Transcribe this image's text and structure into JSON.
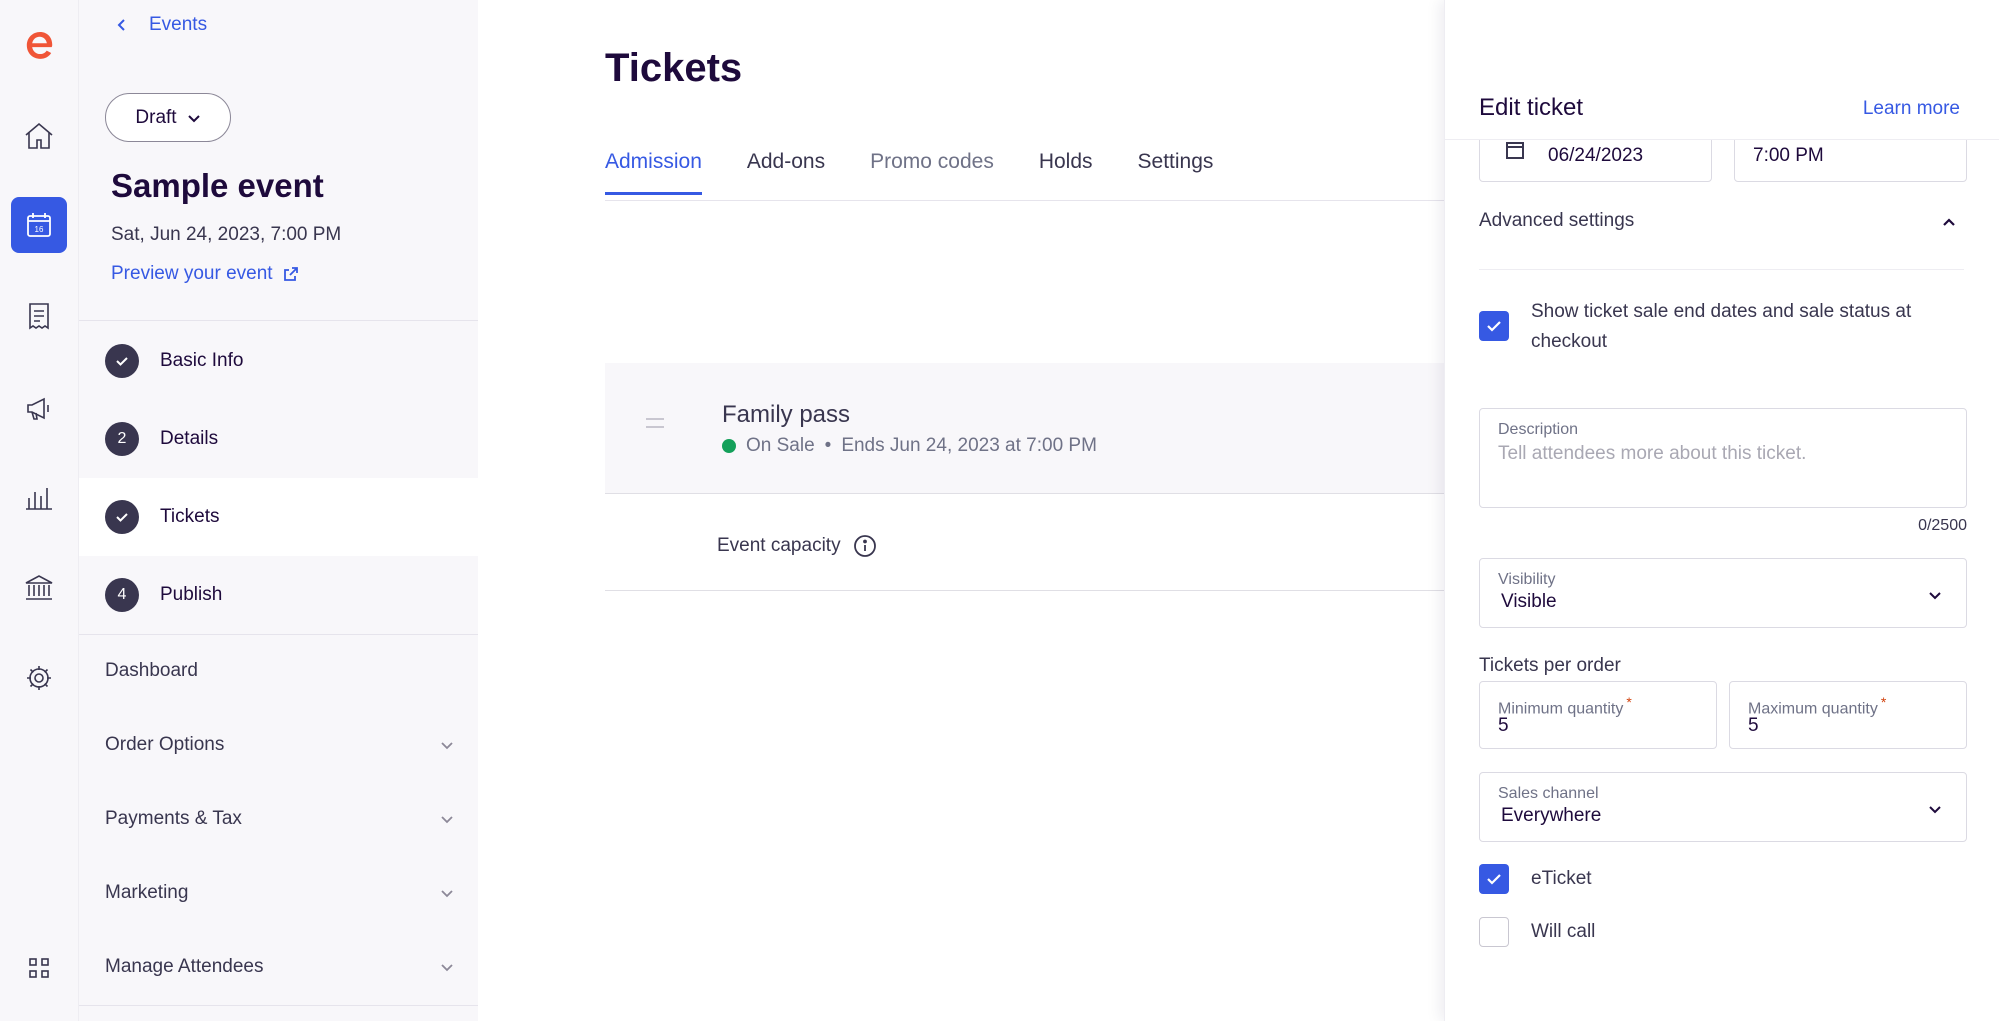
{
  "sidebar": {
    "back_label": "Events",
    "status_button": "Draft",
    "event_title": "Sample event",
    "event_date": "Sat, Jun 24, 2023, 7:00 PM",
    "preview_link": "Preview your event",
    "calendar_day": "16",
    "steps": [
      {
        "label": "Basic Info",
        "marker": "check"
      },
      {
        "label": "Details",
        "marker": "2"
      },
      {
        "label": "Tickets",
        "marker": "check"
      },
      {
        "label": "Publish",
        "marker": "4"
      }
    ],
    "sections": [
      "Dashboard",
      "Order Options",
      "Payments & Tax",
      "Marketing",
      "Manage Attendees"
    ]
  },
  "main": {
    "page_title": "Tickets",
    "tabs": [
      "Admission",
      "Add-ons",
      "Promo codes",
      "Holds",
      "Settings"
    ],
    "active_tab": "Admission",
    "ticket": {
      "name": "Family pass",
      "status": "On Sale",
      "ends": "Ends Jun 24, 2023 at 7:00 PM"
    },
    "capacity_label": "Event capacity"
  },
  "panel": {
    "title": "Edit ticket",
    "learn_more": "Learn more",
    "end_date": "06/24/2023",
    "end_time": "7:00 PM",
    "advanced_settings": "Advanced settings",
    "show_end_dates_label": "Show ticket sale end dates and sale status at checkout",
    "description": {
      "label": "Description",
      "placeholder": "Tell attendees more about this ticket.",
      "counter": "0/2500"
    },
    "visibility": {
      "label": "Visibility",
      "value": "Visible"
    },
    "tickets_per_order": "Tickets per order",
    "min_quantity": {
      "label": "Minimum quantity",
      "value": "5"
    },
    "max_quantity": {
      "label": "Maximum quantity",
      "value": "5"
    },
    "required_mark": "*",
    "sales_channel": {
      "label": "Sales channel",
      "value": "Everywhere"
    },
    "eticket": {
      "label": "eTicket",
      "checked": true
    },
    "will_call": {
      "label": "Will call",
      "checked": false
    }
  },
  "colors": {
    "brand_orange": "#f05537",
    "accent_blue": "#3659e3",
    "on_sale_green": "#14a05a",
    "text_dark": "#1e0a3c"
  }
}
